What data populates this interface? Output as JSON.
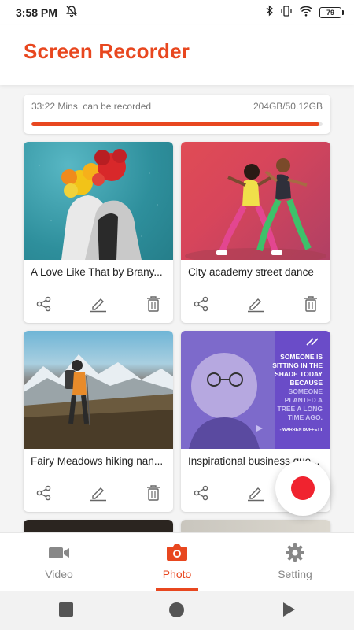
{
  "status_bar": {
    "time": "3:58 PM",
    "battery": "79"
  },
  "header": {
    "title": "Screen Recorder"
  },
  "storage": {
    "recordable_time": "33:22 Mins",
    "recordable_suffix": "can be recorded",
    "size": "204GB/50.12GB",
    "progress_fraction": 0.99,
    "accent": "#e8471f"
  },
  "cards": [
    {
      "caption": "A Love Like That by Brany...",
      "thumb": "illustration-couple-flowers"
    },
    {
      "caption": "City academy street dance",
      "thumb": "photo-dancers"
    },
    {
      "caption": "Fairy Meadows hiking nan...",
      "thumb": "photo-hiker-mountains"
    },
    {
      "caption": "Inspirational business quo...",
      "thumb": "quote-card-portrait"
    }
  ],
  "quote_card": {
    "lines": [
      "SOMEONE IS",
      "SITTING IN THE",
      "SHADE TODAY",
      "BECAUSE"
    ],
    "highlight": [
      "SOMEONE",
      "PLANTED A",
      "TREE A LONG",
      "TIME AGO."
    ],
    "author": "- WARREN BUFFETT"
  },
  "card_actions": [
    "share-icon",
    "edit-icon",
    "delete-icon"
  ],
  "bottom_nav": [
    {
      "label": "Video",
      "icon": "video-camera-icon"
    },
    {
      "label": "Photo",
      "icon": "camera-icon",
      "active": true
    },
    {
      "label": "Setting",
      "icon": "gear-icon"
    }
  ],
  "fab": {
    "icon": "record-icon",
    "color": "#f0232f"
  }
}
